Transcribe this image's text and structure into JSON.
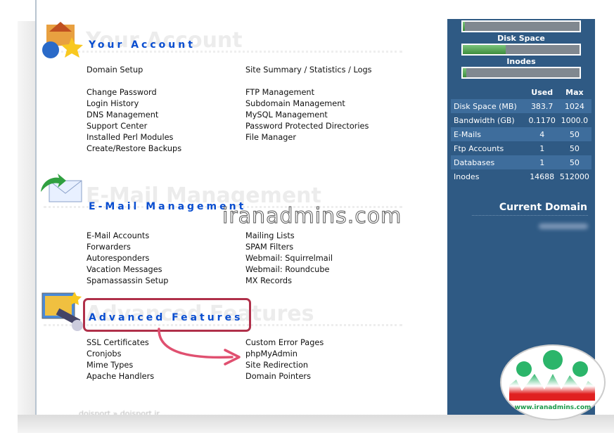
{
  "sections": [
    {
      "title": "Your Account",
      "ghost": "Your Account",
      "icon": "house-globe-star-icon",
      "left": [
        "Domain Setup",
        "",
        "Change Password",
        "Login History",
        "DNS Management",
        "Support Center",
        "Installed Perl Modules",
        "Create/Restore Backups"
      ],
      "right": [
        "Site Summary / Statistics / Logs",
        "",
        "FTP Management",
        "Subdomain Management",
        "MySQL Management",
        "Password Protected Directories",
        "File Manager"
      ]
    },
    {
      "title": "E-Mail Management",
      "ghost": "E-Mail Management",
      "icon": "envelope-arrow-icon",
      "left": [
        "E-Mail Accounts",
        "Forwarders",
        "Autoresponders",
        "Vacation Messages",
        "Spamassassin Setup"
      ],
      "right": [
        "Mailing Lists",
        "SPAM Filters",
        "Webmail: Squirrelmail",
        "Webmail: Roundcube",
        "MX Records"
      ]
    },
    {
      "title": "Advanced Features",
      "ghost": "Advanced Features",
      "icon": "monitor-telescope-icon",
      "left": [
        "SSL Certificates",
        "Cronjobs",
        "Mime Types",
        "Apache Handlers"
      ],
      "right": [
        "Custom Error Pages",
        "phpMyAdmin",
        "Site Redirection",
        "Domain Pointers"
      ]
    }
  ],
  "breadcrumb": "doisport » doisport.ir",
  "sidebar": {
    "bars": [
      {
        "label": "",
        "percent": 1
      },
      {
        "label": "Disk Space",
        "percent": 37
      },
      {
        "label": "Inodes",
        "percent": 3
      }
    ],
    "headers": [
      "",
      "Used",
      "Max"
    ],
    "rows": [
      [
        "Disk Space (MB)",
        "383.7",
        "1024"
      ],
      [
        "Bandwidth (GB)",
        "0.1170",
        "1000.0"
      ],
      [
        "E-Mails",
        "4",
        "50"
      ],
      [
        "Ftp Accounts",
        "1",
        "50"
      ],
      [
        "Databases",
        "1",
        "50"
      ],
      [
        "Inodes",
        "14688",
        "512000"
      ]
    ],
    "current_domain": "Current Domain"
  },
  "watermark": "iranadmins.com",
  "logo_text": "www.iranadmins.com",
  "colors": {
    "title": "#0a4ed0",
    "sidebar": "#2f5a84",
    "highlight": "#b0304a",
    "arrow": "#e05070"
  }
}
